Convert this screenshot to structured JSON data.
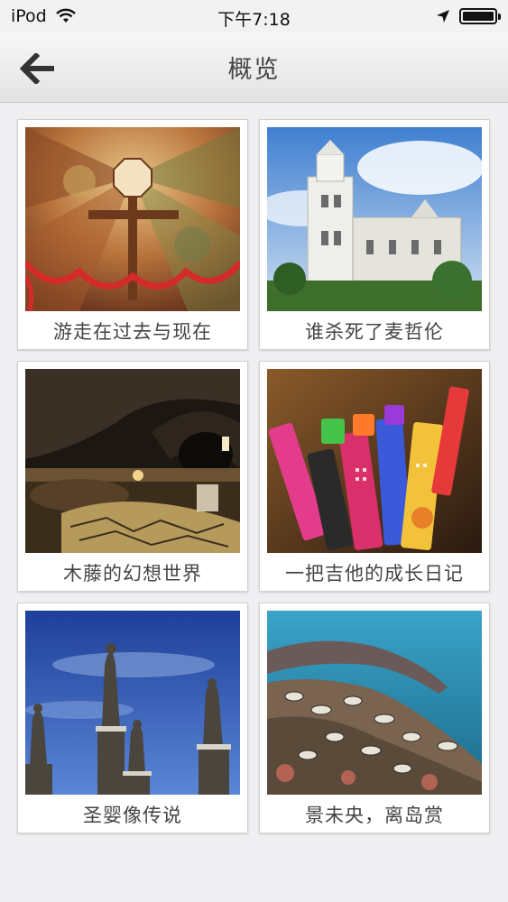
{
  "status_bar": {
    "carrier": "iPod",
    "time": "下午7:18"
  },
  "nav": {
    "title": "概览",
    "back_icon": "arrow-left-icon"
  },
  "cards": [
    {
      "title": "游走在过去与现在",
      "image": "church-dome-painting-cross"
    },
    {
      "title": "谁杀死了麦哲伦",
      "image": "white-cathedral-facade"
    },
    {
      "title": "木藤的幻想世界",
      "image": "rattan-interior-restaurant"
    },
    {
      "title": "一把吉他的成长日记",
      "image": "colorful-miniature-guitars"
    },
    {
      "title": "圣婴像传说",
      "image": "stone-statues-sky"
    },
    {
      "title": "景未央，离岛赏",
      "image": "coral-reef-fish"
    }
  ],
  "colors": {
    "background": "#efeff1",
    "nav_gradient_top": "#f7f7f7",
    "nav_gradient_bottom": "#e3e3e3",
    "caption_text": "#444444"
  }
}
